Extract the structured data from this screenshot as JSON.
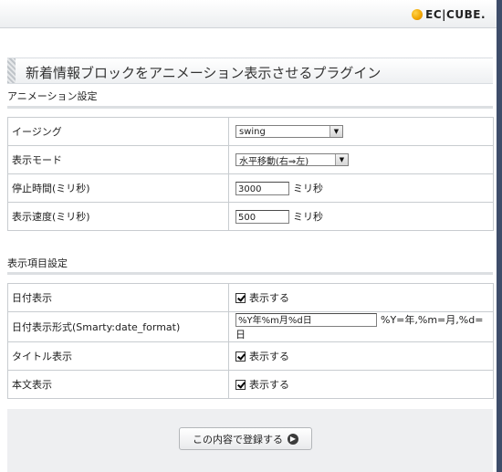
{
  "header": {
    "logo_text": "EC|CUBE."
  },
  "page_title": "新着情報ブロックをアニメーション表示させるプラグイン",
  "animation_section": {
    "title": "アニメーション設定",
    "rows": {
      "easing": {
        "label": "イージング",
        "value": "swing"
      },
      "display_mode": {
        "label": "表示モード",
        "value": "水平移動(右⇒左)"
      },
      "stop_time": {
        "label": "停止時間(ミリ秒)",
        "value": "3000",
        "unit": "ミリ秒"
      },
      "display_speed": {
        "label": "表示速度(ミリ秒)",
        "value": "500",
        "unit": "ミリ秒"
      }
    }
  },
  "display_section": {
    "title": "表示項目設定",
    "rows": {
      "date_display": {
        "label": "日付表示",
        "checkbox_label": "表示する",
        "checked": true
      },
      "date_format": {
        "label": "日付表示形式(Smarty:date_format)",
        "value": "%Y年%m月%d日",
        "hint": "%Y=年,%m=月,%d=日"
      },
      "title_display": {
        "label": "タイトル表示",
        "checkbox_label": "表示する",
        "checked": true
      },
      "body_display": {
        "label": "本文表示",
        "checkbox_label": "表示する",
        "checked": true
      }
    }
  },
  "submit_label": "この内容で登録する",
  "icons": {
    "logo": "ec-cube-logo-icon",
    "submit": "arrow-right-circle-icon",
    "dropdown": "dropdown-arrow-icon",
    "checkbox": "checkbox-checked-icon"
  }
}
